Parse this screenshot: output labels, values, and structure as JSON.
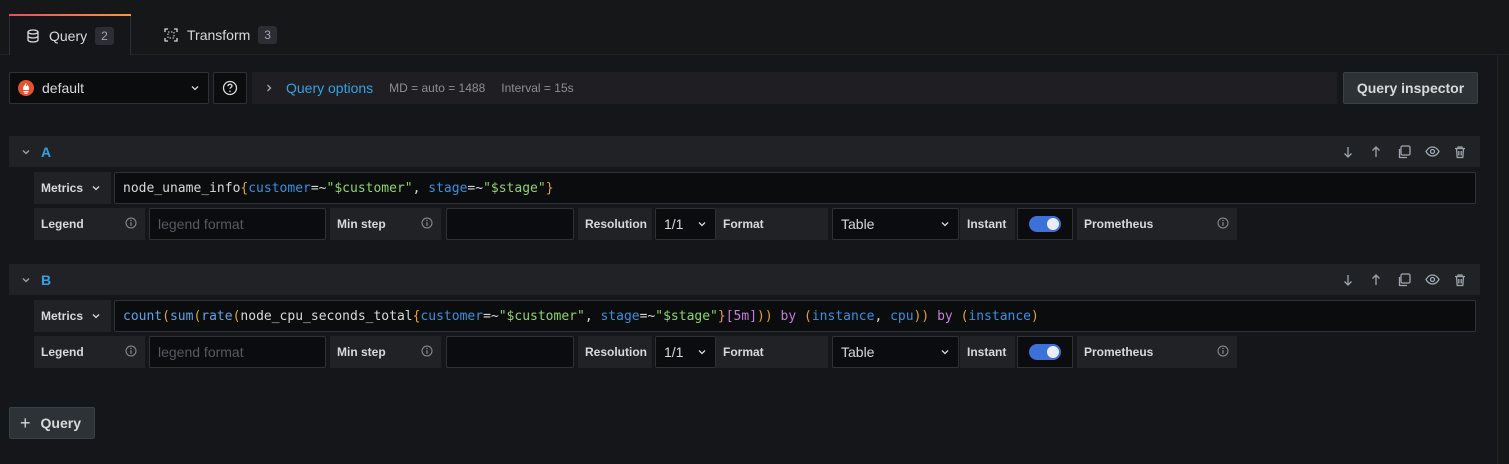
{
  "tabs": [
    {
      "label": "Query",
      "count": "2",
      "icon": "database-icon"
    },
    {
      "label": "Transform",
      "count": "3",
      "icon": "transform-icon"
    }
  ],
  "datasource": {
    "name": "default",
    "icon": "prometheus-icon"
  },
  "query_options": {
    "title": "Query options",
    "md": "MD = auto = 1488",
    "interval": "Interval = 15s"
  },
  "inspector": {
    "label": "Query inspector"
  },
  "queries": [
    {
      "ref_id": "A",
      "metrics_label": "Metrics",
      "expr": "node_uname_info{customer=~\"$customer\", stage=~\"$stage\"}",
      "legend_label": "Legend",
      "legend_placeholder": "legend format",
      "min_step_label": "Min step",
      "min_step_value": "",
      "resolution_label": "Resolution",
      "resolution_value": "1/1",
      "format_label": "Format",
      "format_value": "Table",
      "instant_label": "Instant",
      "instant_on": true,
      "prometheus_label": "Prometheus"
    },
    {
      "ref_id": "B",
      "metrics_label": "Metrics",
      "expr": "count(sum(rate(node_cpu_seconds_total{customer=~\"$customer\", stage=~\"$stage\"}[5m])) by (instance, cpu)) by (instance)",
      "legend_label": "Legend",
      "legend_placeholder": "legend format",
      "min_step_label": "Min step",
      "min_step_value": "",
      "resolution_label": "Resolution",
      "resolution_value": "1/1",
      "format_label": "Format",
      "format_value": "Table",
      "instant_label": "Instant",
      "instant_on": true,
      "prometheus_label": "Prometheus"
    }
  ],
  "add_query": {
    "label": "Query"
  },
  "colors": {
    "accent": "#33a2e5",
    "toggle_on": "#3d71d9",
    "tab_gradient_start": "#f2495c",
    "tab_gradient_end": "#ff9830"
  }
}
